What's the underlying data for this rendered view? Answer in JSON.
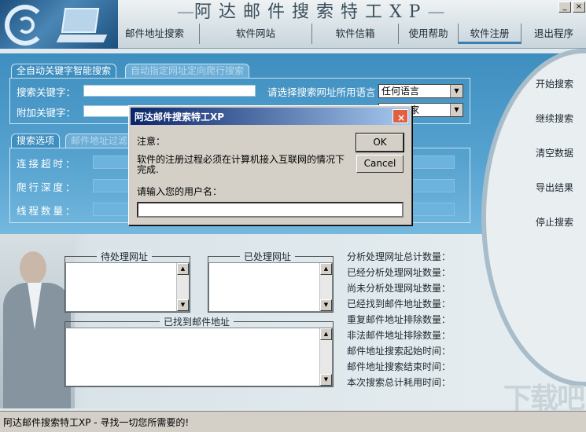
{
  "app": {
    "title": "阿达邮件搜索特工XP",
    "title_dash": "—",
    "min_icon": "minimize-icon",
    "close_icon": "close-icon"
  },
  "menu": {
    "items": [
      "邮件地址搜索",
      "软件网站",
      "软件信箱",
      "使用帮助",
      "软件注册",
      "退出程序"
    ],
    "active": "软件注册"
  },
  "side_buttons": [
    "开始搜索",
    "继续搜索",
    "清空数据",
    "导出结果",
    "停止搜索"
  ],
  "keyword_panel": {
    "tabs": [
      "全自动关键字智能搜索",
      "自动指定网址定向爬行搜索"
    ],
    "search_keyword_label": "搜索关键字：",
    "search_keyword_value": "",
    "extra_keyword_label": "附加关键字：",
    "extra_keyword_value": "",
    "language_label": "请选择搜索网址所用语言",
    "language_value": "任何语言",
    "second_combo_value": "家"
  },
  "options_panel": {
    "tabs": [
      "搜索选项",
      "邮件地址过滤"
    ],
    "connect_timeout_label": "连接超时：",
    "crawl_depth_label": "爬行深度：",
    "thread_count_label": "线程数量："
  },
  "lists": {
    "pending_title": "待处理网址",
    "processed_title": "已处理网址",
    "found_title": "已找到邮件地址"
  },
  "stats": [
    "分析处理网址总计数量：",
    "已经分析处理网址数量：",
    "尚未分析处理网址数量：",
    "已经找到邮件地址数量：",
    "重复邮件地址排除数量：",
    "非法邮件地址排除数量：",
    "邮件地址搜索起始时间：",
    "邮件地址搜索结束时间：",
    "本次搜索总计耗用时间："
  ],
  "status_text": "阿达邮件搜索特工XP - 寻找一切您所需要的!",
  "watermark": "下载吧",
  "dialog": {
    "title": "阿达邮件搜索特工XP",
    "notice_label": "注意：",
    "message": "软件的注册过程必须在计算机接入互联网的情况下完成.",
    "prompt": "请输入您的用户名：",
    "ok_label": "OK",
    "cancel_label": "Cancel",
    "username_value": ""
  },
  "colors": {
    "panel_blue": "#3e8ebf",
    "titlebar": "#0a246a",
    "close_button": "#e06040"
  }
}
